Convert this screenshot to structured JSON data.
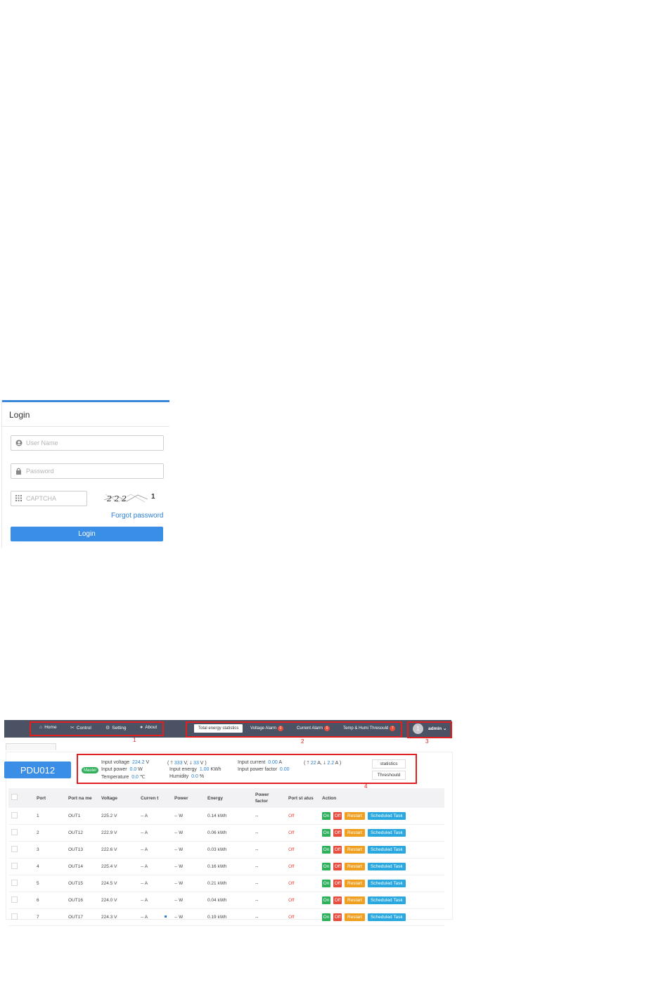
{
  "login": {
    "title": "Login",
    "username_placeholder": "User Name",
    "password_placeholder": "Password",
    "captcha_placeholder": "CAPTCHA",
    "captcha_text": "2 2 2",
    "captcha_extra_digit": "1",
    "forgot_label": "Forgot password",
    "login_button": "Login"
  },
  "nav": {
    "items": [
      {
        "label": "Home",
        "icon": "home-icon"
      },
      {
        "label": "Control",
        "icon": "control-icon"
      },
      {
        "label": "Setting",
        "icon": "gear-icon"
      },
      {
        "label": "About",
        "icon": "info-icon"
      }
    ],
    "tabs": [
      {
        "label": "Total energy statistics",
        "badge": ""
      },
      {
        "label": "Voltage Alarm",
        "badge": "0"
      },
      {
        "label": "Current Alarm",
        "badge": "0"
      },
      {
        "label": "Temp & Humi Thresould",
        "badge": "7"
      }
    ],
    "user": "admin",
    "avatar_initial": "1"
  },
  "region_labels": [
    "1",
    "2",
    "3",
    "4"
  ],
  "device": {
    "name": "PDU012",
    "master_label": "Master",
    "input_voltage_label": "Input voltage",
    "input_voltage_value": "224.2",
    "input_voltage_unit": "V",
    "voltage_range_open": "(",
    "voltage_up": "333",
    "voltage_down": "33",
    "voltage_unit_close": "V )",
    "input_power_label": "Input power",
    "input_power_value": "0.0",
    "input_power_unit": "W",
    "temperature_label": "Temperature",
    "temperature_value": "0.0",
    "temperature_unit": "℃",
    "input_energy_label": "Input energy",
    "input_energy_value": "1.00",
    "input_energy_unit": "KWh",
    "humidity_label": "Humidity",
    "humidity_value": "0.0",
    "humidity_unit": "%",
    "input_current_label": "Input current",
    "input_current_value": "0.00",
    "input_current_unit": "A",
    "current_up": "22",
    "current_down": "2.2",
    "input_pf_label": "Input power factor",
    "input_pf_value": "0.00",
    "statistics_button": "statistics",
    "threshold_button": "Threshould"
  },
  "table": {
    "headers": [
      "Port",
      "Port na me",
      "Voltage",
      "Curren t",
      "Power",
      "Energy",
      "Power factor",
      "Port st atus",
      "Action"
    ],
    "action_labels": {
      "on": "On",
      "off": "Off",
      "restart": "Restart",
      "scheduled": "Scheduled Task"
    },
    "rows": [
      {
        "port": "1",
        "name": "OUT1",
        "voltage": "225.2 V",
        "current": "-- A",
        "power": "-- W",
        "energy": "0.14 kWh",
        "pf": "--",
        "status": "Off"
      },
      {
        "port": "2",
        "name": "OUT12",
        "voltage": "222.9 V",
        "current": "-- A",
        "power": "-- W",
        "energy": "0.06 kWh",
        "pf": "--",
        "status": "Off"
      },
      {
        "port": "3",
        "name": "OUT13",
        "voltage": "222.6 V",
        "current": "-- A",
        "power": "-- W",
        "energy": "0.03 kWh",
        "pf": "--",
        "status": "Off"
      },
      {
        "port": "4",
        "name": "OUT14",
        "voltage": "225.4 V",
        "current": "-- A",
        "power": "-- W",
        "energy": "0.16 kWh",
        "pf": "--",
        "status": "Off"
      },
      {
        "port": "5",
        "name": "OUT15",
        "voltage": "224.5 V",
        "current": "-- A",
        "power": "-- W",
        "energy": "0.21 kWh",
        "pf": "--",
        "status": "Off"
      },
      {
        "port": "6",
        "name": "OUT16",
        "voltage": "224.0 V",
        "current": "-- A",
        "power": "-- W",
        "energy": "0.04 kWh",
        "pf": "--",
        "status": "Off"
      },
      {
        "port": "7",
        "name": "OUT17",
        "voltage": "224.3 V",
        "current": "-- A",
        "power": "-- W",
        "energy": "0.19 kWh",
        "pf": "--",
        "status": "Off"
      }
    ]
  },
  "colors": {
    "nav_bg": "#4a5264",
    "primary_blue": "#3b8ee6",
    "annotation_red": "#e02020",
    "on_green": "#2eaf5a",
    "off_red": "#e84c3d",
    "restart_orange": "#f0a020",
    "scheduled_cyan": "#29a8e0"
  }
}
